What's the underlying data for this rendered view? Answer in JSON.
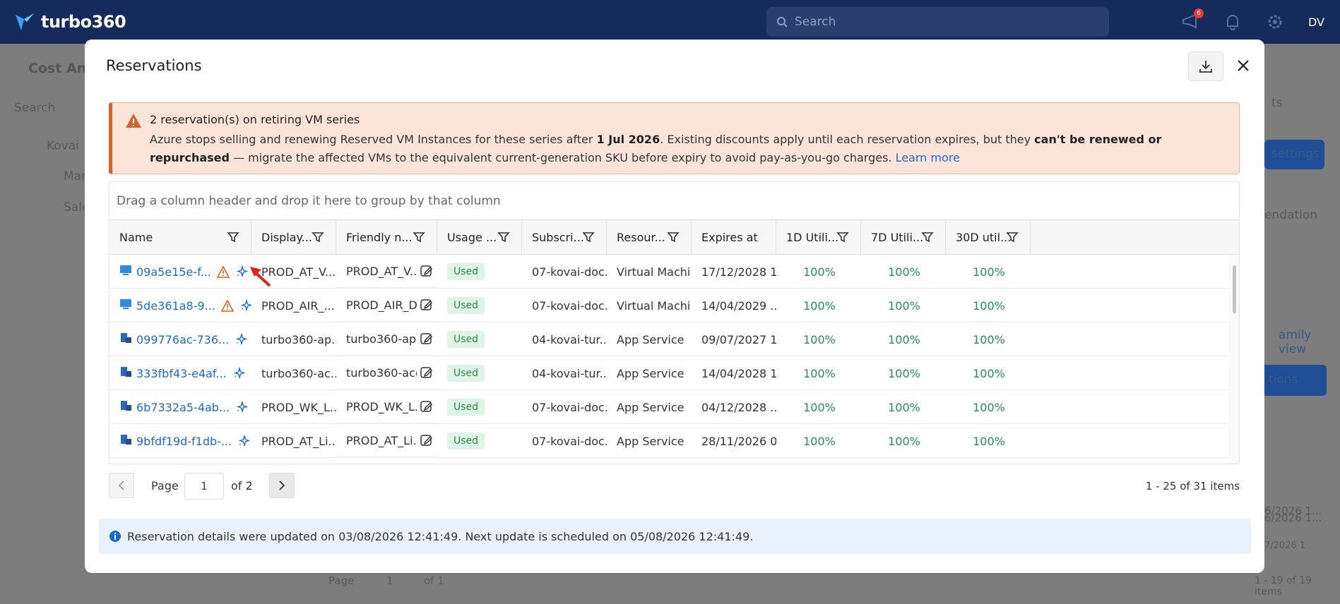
{
  "app": {
    "name": "turbo360",
    "search_placeholder": "Search",
    "notification_count": "6",
    "user_initials": "DV"
  },
  "background": {
    "page_title": "Cost An",
    "side_search": "Search",
    "tree_root": "Kovai",
    "tree_items": [
      "Man",
      "Sale"
    ],
    "right_labels": [
      "ts",
      "settings",
      "endation",
      "amily view",
      "tions"
    ],
    "bottom_pager": {
      "page": "1",
      "of": "of 1",
      "label": "Page",
      "count": "1 - 19 of 19 items"
    },
    "right_dates": [
      "6/2026 1...",
      "6/2026 1...",
      "7/2026 1"
    ]
  },
  "modal": {
    "title": "Reservations",
    "alert": {
      "title": "2 reservation(s) on retiring VM series",
      "body_1": "Azure stops selling and renewing Reserved VM Instances for these series after ",
      "bold_1": "1 Jul 2026",
      "body_2": ". Existing discounts apply until each reservation expires, but they ",
      "bold_2": "can't be renewed or repurchased",
      "body_3": " — migrate the affected VMs to the equivalent current-generation SKU before expiry to avoid pay-as-you-go charges. ",
      "link": "Learn more"
    },
    "group_hint": "Drag a column header and drop it here to group by that column",
    "columns": [
      "Name",
      "Display...",
      "Friendly n...",
      "Usage ...",
      "Subscri...",
      "Resour...",
      "Expires at",
      "1D Utili...",
      "7D Utili...",
      "30D util..."
    ],
    "rows": [
      {
        "name": "09a5e15e-f...",
        "display": "PROD_AT_V...",
        "friendly": "PROD_AT_V...",
        "usage": "Used",
        "subscription": "07-kovai-doc...",
        "resource": "Virtual Machi...",
        "expires": "17/12/2028 1...",
        "u1": "100%",
        "u7": "100%",
        "u30": "100%",
        "type": "vm",
        "warn": true
      },
      {
        "name": "5de361a8-9...",
        "display": "PROD_AIR_...",
        "friendly": "PROD_AIR_D...",
        "usage": "Used",
        "subscription": "07-kovai-doc...",
        "resource": "Virtual Machi...",
        "expires": "14/04/2029 ...",
        "u1": "100%",
        "u7": "100%",
        "u30": "100%",
        "type": "vm",
        "warn": true
      },
      {
        "name": "099776ac-736...",
        "display": "turbo360-ap...",
        "friendly": "turbo360-ap...",
        "usage": "Used",
        "subscription": "04-kovai-tur...",
        "resource": "App Service",
        "expires": "09/07/2027 1...",
        "u1": "100%",
        "u7": "100%",
        "u30": "100%",
        "type": "app",
        "warn": false
      },
      {
        "name": "333fbf43-e4af...",
        "display": "turbo360-ac...",
        "friendly": "turbo360-aco...",
        "usage": "Used",
        "subscription": "04-kovai-tur...",
        "resource": "App Service",
        "expires": "14/04/2028 1...",
        "u1": "100%",
        "u7": "100%",
        "u30": "100%",
        "type": "app",
        "warn": false
      },
      {
        "name": "6b7332a5-4ab...",
        "display": "PROD_WK_L...",
        "friendly": "PROD_WK_L...",
        "usage": "Used",
        "subscription": "07-kovai-doc...",
        "resource": "App Service",
        "expires": "04/12/2028 ...",
        "u1": "100%",
        "u7": "100%",
        "u30": "100%",
        "type": "app",
        "warn": false
      },
      {
        "name": "9bfdf19d-f1db-...",
        "display": "PROD_AT_Li...",
        "friendly": "PROD_AT_Li...",
        "usage": "Used",
        "subscription": "07-kovai-doc...",
        "resource": "App Service",
        "expires": "28/11/2026 0...",
        "u1": "100%",
        "u7": "100%",
        "u30": "100%",
        "type": "app",
        "warn": false
      }
    ],
    "pager": {
      "label": "Page",
      "current": "1",
      "of": "of 2",
      "count": "1 - 25 of 31 items"
    },
    "info": "Reservation details were updated on 03/08/2026 12:41:49. Next update is scheduled on 05/08/2026 12:41:49."
  },
  "colors": {
    "link": "#1b6ad3",
    "success": "#229057",
    "warning": "#d9622b",
    "topbar": "#152b5c"
  }
}
